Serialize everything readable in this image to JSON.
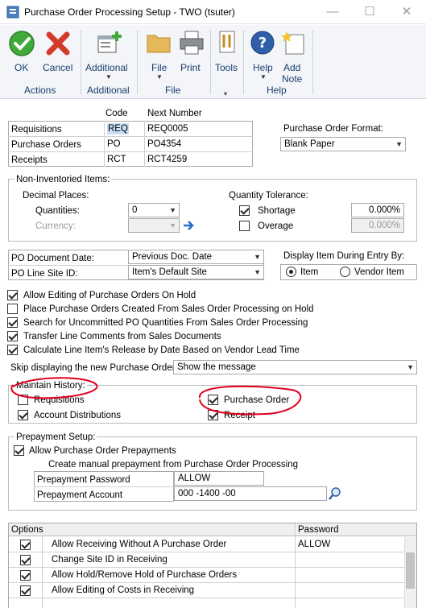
{
  "window": {
    "title": "Purchase Order Processing Setup  -  TWO (tsuter)",
    "controls": {
      "minimize": "—",
      "maximize": "☐",
      "close": "✕"
    }
  },
  "ribbon": {
    "ok": "OK",
    "cancel": "Cancel",
    "additional": "Additional",
    "file": "File",
    "print": "Print",
    "tools": "Tools",
    "help": "Help",
    "add_note_1": "Add",
    "add_note_2": "Note",
    "groups": {
      "actions": "Actions",
      "additional": "Additional",
      "file": "File",
      "help": "Help"
    }
  },
  "numbers": {
    "col_code": "Code",
    "col_next": "Next Number",
    "rows": [
      {
        "label": "Requisitions",
        "code": "REQ",
        "next": "REQ0005"
      },
      {
        "label": "Purchase Orders",
        "code": "PO",
        "next": "PO4354"
      },
      {
        "label": "Receipts",
        "code": "RCT",
        "next": "RCT4259"
      }
    ]
  },
  "po_format": {
    "label": "Purchase Order Format:",
    "value": "Blank Paper"
  },
  "non_inventoried": {
    "title": "Non-Inventoried Items:",
    "decimal_places": "Decimal Places:",
    "quantities_label": "Quantities:",
    "quantities_value": "0",
    "currency_label": "Currency:",
    "currency_value": "",
    "tolerance_title": "Quantity Tolerance:",
    "shortage_label": "Shortage",
    "shortage_value": "0.000%",
    "overage_label": "Overage",
    "overage_value": "0.000%"
  },
  "po_document_date": {
    "label": "PO Document Date:",
    "value": "Previous Doc. Date"
  },
  "po_line_site": {
    "label": "PO Line Site ID:",
    "value": "Item's Default Site"
  },
  "display_item": {
    "label": "Display Item During Entry By:",
    "item": "Item",
    "vendor_item": "Vendor Item"
  },
  "options_checks": [
    "Allow Editing of Purchase Orders On Hold",
    "Place Purchase Orders Created From Sales Order Processing on Hold",
    "Search for Uncommitted PO Quantities From Sales Order Processing",
    "Transfer Line Comments from Sales Documents",
    "Calculate Line Item's Release by Date Based on Vendor Lead Time"
  ],
  "skip_display": {
    "label": "Skip displaying the new Purchase Order:",
    "value": "Show the message"
  },
  "maintain_history": {
    "title": "Maintain History:",
    "requisitions": "Requisitions",
    "account_distributions": "Account Distributions",
    "purchase_order": "Purchase Order",
    "receipt": "Receipt"
  },
  "prepayment": {
    "title": "Prepayment Setup:",
    "allow_label": "Allow Purchase Order Prepayments",
    "manual_label": "Create manual prepayment from Purchase Order Processing",
    "password_label": "Prepayment Password",
    "password_value": "ALLOW",
    "account_label": "Prepayment Account",
    "account_value": "000 -1400 -00"
  },
  "options_grid": {
    "col_options": "Options",
    "col_password": "Password",
    "rows": [
      {
        "label": "Allow Receiving Without A Purchase Order",
        "password": "ALLOW",
        "checked": true
      },
      {
        "label": "Change Site ID in Receiving",
        "password": "",
        "checked": true
      },
      {
        "label": "Allow Hold/Remove Hold of Purchase Orders",
        "password": "",
        "checked": true
      },
      {
        "label": "Allow Editing of Costs in Receiving",
        "password": "",
        "checked": true
      }
    ]
  },
  "colors": {
    "accent": "#1a3f6e",
    "annotation_red": "#e0001b",
    "highlight": "#c8dff7"
  }
}
